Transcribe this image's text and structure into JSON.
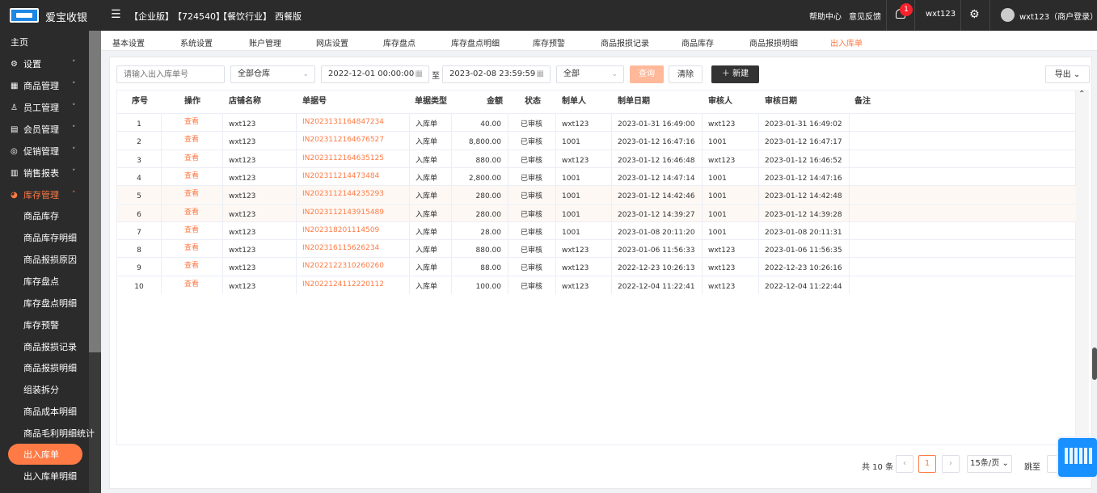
{
  "header": {
    "app_name": "爱宝收银",
    "tags": [
      "【企业版】",
      "【724540】",
      "【餐饮行业】",
      "西餐版"
    ],
    "help": "帮助中心",
    "feedback": "意见反馈",
    "notif_count": "1",
    "user": "wxt123",
    "account": "wxt123（商户登录）"
  },
  "sidebar": {
    "home": "主页",
    "groups": [
      {
        "icon": "⚙",
        "label": "设置",
        "chev": "˅"
      },
      {
        "icon": "▦",
        "label": "商品管理",
        "chev": "˅"
      },
      {
        "icon": "♙",
        "label": "员工管理",
        "chev": "˅"
      },
      {
        "icon": "▤",
        "label": "会员管理",
        "chev": "˅"
      },
      {
        "icon": "◎",
        "label": "促销管理",
        "chev": "˅"
      },
      {
        "icon": "▥",
        "label": "销售报表",
        "chev": "˅"
      },
      {
        "icon": "◕",
        "label": "库存管理",
        "chev": "˄"
      }
    ],
    "subitems": [
      "商品库存",
      "商品库存明细",
      "商品报损原因",
      "库存盘点",
      "库存盘点明细",
      "库存预警",
      "商品报损记录",
      "商品报损明细",
      "组装拆分",
      "商品成本明细",
      "商品毛利明细统计",
      "出入库单",
      "出入库单明细"
    ]
  },
  "tabs": [
    "基本设置",
    "系统设置",
    "账户管理",
    "网店设置",
    "库存盘点",
    "库存盘点明细",
    "库存预警",
    "商品报损记录",
    "商品库存",
    "商品报损明细",
    "出入库单"
  ],
  "filters": {
    "search_placeholder": "请输入出入库单号",
    "warehouse": "全部仓库",
    "start": "2022-12-01 00:00:00",
    "to": "至",
    "end": "2023-02-08 23:59:59",
    "type": "全部",
    "query": "查询",
    "clear": "清除",
    "new": "＋ 新建",
    "export": "导出 ⌄"
  },
  "table": {
    "headers": [
      "序号",
      "操作",
      "店铺名称",
      "单据号",
      "单据类型",
      "金额",
      "状态",
      "制单人",
      "制单日期",
      "审核人",
      "审核日期",
      "备注"
    ],
    "rows": [
      {
        "no": "1",
        "op": "查看",
        "store": "wxt123",
        "doc": "IN2023131164847234",
        "type": "入库单",
        "amount": "40.00",
        "status": "已审核",
        "maker": "wxt123",
        "mdate": "2023-01-31 16:49:00",
        "auditor": "wxt123",
        "adate": "2023-01-31 16:49:02"
      },
      {
        "no": "2",
        "op": "查看",
        "store": "wxt123",
        "doc": "IN2023112164676527",
        "type": "入库单",
        "amount": "8,800.00",
        "status": "已审核",
        "maker": "1001",
        "mdate": "2023-01-12 16:47:16",
        "auditor": "1001",
        "adate": "2023-01-12 16:47:17"
      },
      {
        "no": "3",
        "op": "查看",
        "store": "wxt123",
        "doc": "IN2023112164635125",
        "type": "入库单",
        "amount": "880.00",
        "status": "已审核",
        "maker": "wxt123",
        "mdate": "2023-01-12 16:46:48",
        "auditor": "wxt123",
        "adate": "2023-01-12 16:46:52"
      },
      {
        "no": "4",
        "op": "查看",
        "store": "wxt123",
        "doc": "IN202311214473484",
        "type": "入库单",
        "amount": "2,800.00",
        "status": "已审核",
        "maker": "1001",
        "mdate": "2023-01-12 14:47:14",
        "auditor": "1001",
        "adate": "2023-01-12 14:47:16"
      },
      {
        "no": "5",
        "op": "查看",
        "store": "wxt123",
        "doc": "IN2023112144235293",
        "type": "入库单",
        "amount": "280.00",
        "status": "已审核",
        "maker": "1001",
        "mdate": "2023-01-12 14:42:46",
        "auditor": "1001",
        "adate": "2023-01-12 14:42:48"
      },
      {
        "no": "6",
        "op": "查看",
        "store": "wxt123",
        "doc": "IN2023112143915489",
        "type": "入库单",
        "amount": "280.00",
        "status": "已审核",
        "maker": "1001",
        "mdate": "2023-01-12 14:39:27",
        "auditor": "1001",
        "adate": "2023-01-12 14:39:28"
      },
      {
        "no": "7",
        "op": "查看",
        "store": "wxt123",
        "doc": "IN202318201114509",
        "type": "入库单",
        "amount": "28.00",
        "status": "已审核",
        "maker": "1001",
        "mdate": "2023-01-08 20:11:20",
        "auditor": "1001",
        "adate": "2023-01-08 20:11:31"
      },
      {
        "no": "8",
        "op": "查看",
        "store": "wxt123",
        "doc": "IN202316115626234",
        "type": "入库单",
        "amount": "880.00",
        "status": "已审核",
        "maker": "wxt123",
        "mdate": "2023-01-06 11:56:33",
        "auditor": "wxt123",
        "adate": "2023-01-06 11:56:35"
      },
      {
        "no": "9",
        "op": "查看",
        "store": "wxt123",
        "doc": "IN2022122310260260",
        "type": "入库单",
        "amount": "88.00",
        "status": "已审核",
        "maker": "wxt123",
        "mdate": "2022-12-23 10:26:13",
        "auditor": "wxt123",
        "adate": "2022-12-23 10:26:16"
      },
      {
        "no": "10",
        "op": "查看",
        "store": "wxt123",
        "doc": "IN2022124112220112",
        "type": "入库单",
        "amount": "100.00",
        "status": "已审核",
        "maker": "wxt123",
        "mdate": "2022-12-04 11:22:41",
        "auditor": "wxt123",
        "adate": "2022-12-04 11:22:44"
      }
    ]
  },
  "pager": {
    "total": "共 10 条",
    "prev": "‹",
    "page": "1",
    "next": "›",
    "size": "15条/页 ⌄",
    "jump": "跳至"
  }
}
